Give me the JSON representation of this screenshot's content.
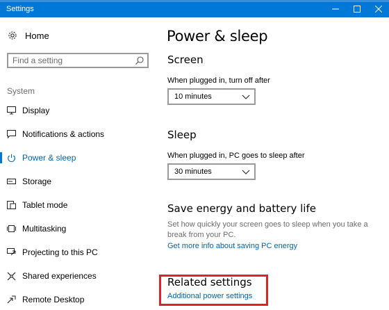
{
  "window": {
    "title": "Settings"
  },
  "sidebar": {
    "home_label": "Home",
    "search_placeholder": "Find a setting",
    "section_label": "System",
    "items": [
      {
        "label": "Display",
        "icon": "display-icon",
        "active": false
      },
      {
        "label": "Notifications & actions",
        "icon": "notifications-icon",
        "active": false
      },
      {
        "label": "Power & sleep",
        "icon": "power-icon",
        "active": true
      },
      {
        "label": "Storage",
        "icon": "storage-icon",
        "active": false
      },
      {
        "label": "Tablet mode",
        "icon": "tablet-mode-icon",
        "active": false
      },
      {
        "label": "Multitasking",
        "icon": "multitasking-icon",
        "active": false
      },
      {
        "label": "Projecting to this PC",
        "icon": "projecting-icon",
        "active": false
      },
      {
        "label": "Shared experiences",
        "icon": "shared-experiences-icon",
        "active": false
      },
      {
        "label": "Remote Desktop",
        "icon": "remote-desktop-icon",
        "active": false
      }
    ]
  },
  "main": {
    "title": "Power & sleep",
    "screen": {
      "heading": "Screen",
      "label": "When plugged in, turn off after",
      "value": "10 minutes"
    },
    "sleep": {
      "heading": "Sleep",
      "label": "When plugged in, PC goes to sleep after",
      "value": "30 minutes"
    },
    "save_energy": {
      "heading": "Save energy and battery life",
      "description": "Set how quickly your screen goes to sleep when you take a break from your PC.",
      "link": "Get more info about saving PC energy"
    },
    "related": {
      "heading": "Related settings",
      "link": "Additional power settings"
    }
  },
  "colors": {
    "accent": "#0078d7",
    "link": "#0063b1",
    "highlight": "#e2202c"
  }
}
